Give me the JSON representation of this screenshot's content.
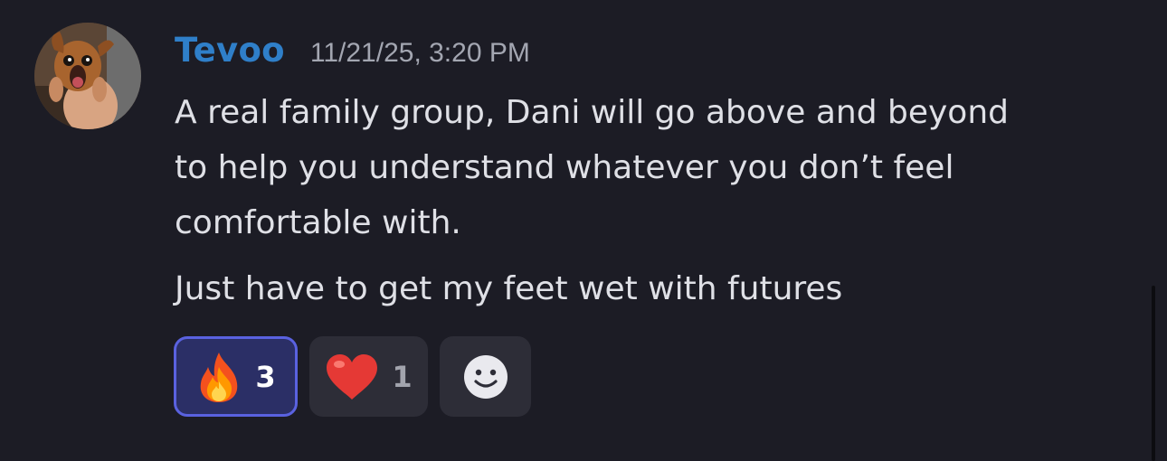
{
  "message": {
    "username": "Tevoo",
    "timestamp": "11/21/25, 3:20 PM",
    "lines": [
      "A real family group, Dani will go above and beyond",
      "to help you understand whatever you don’t feel",
      "comfortable with.",
      "Just have to get my feet wet with futures"
    ]
  },
  "reactions": [
    {
      "icon": "fire-emoji",
      "count": "3",
      "selected": true
    },
    {
      "icon": "heart-emoji",
      "count": "1",
      "selected": false
    },
    {
      "icon": "add-reaction-smiley-icon"
    }
  ],
  "colors": {
    "background": "#1c1c25",
    "username": "#2f7fc9",
    "text": "#dfe0e6",
    "timestamp": "#a3a6b1",
    "selected_reaction_bg": "#2b2f66",
    "selected_reaction_border": "#5a62e0",
    "reaction_bg": "#2d2d37"
  }
}
